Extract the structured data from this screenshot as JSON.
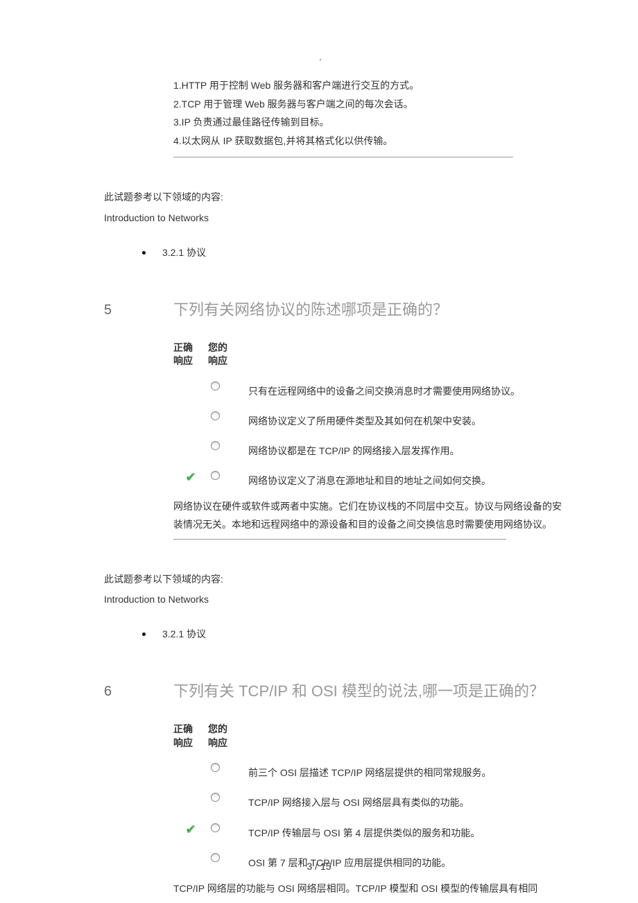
{
  "page_marker": ".",
  "top_explanation": {
    "lines": [
      "1.HTTP 用于控制 Web 服务器和客户端进行交互的方式。",
      "2.TCP 用于管理 Web 服务器与客户端之间的每次会话。",
      "3.IP 负责通过最佳路径传输到目标。",
      "4.以太网从 IP 获取数据包,并将其格式化以供传输。"
    ]
  },
  "reference1": {
    "intro": "此试题参考以下领域的内容:",
    "course": "Introduction to Networks",
    "bullet": "3.2.1 协议"
  },
  "question5": {
    "number": "5",
    "title": "下列有关网络协议的陈述哪项是正确的？",
    "header_correct_l1": "正确",
    "header_correct_l2": "响应",
    "header_your_l1": "您的",
    "header_your_l2": "响应",
    "options": [
      {
        "text": "只有在远程网络中的设备之间交换消息时才需要使用网络协议。",
        "correct": false
      },
      {
        "text": "网络协议定义了所用硬件类型及其如何在机架中安装。",
        "correct": false
      },
      {
        "text": "网络协议都是在 TCP/IP 的网络接入层发挥作用。",
        "correct": false
      },
      {
        "text": "网络协议定义了消息在源地址和目的地址之间如何交换。",
        "correct": true
      }
    ],
    "explanation": "网络协议在硬件或软件或两者中实施。它们在协议栈的不同层中交互。协议与网络设备的安装情况无关。本地和远程网络中的源设备和目的设备之间交换信息时需要使用网络协议。"
  },
  "reference2": {
    "intro": "此试题参考以下领域的内容:",
    "course": "Introduction to Networks",
    "bullet": "3.2.1 协议"
  },
  "question6": {
    "number": "6",
    "title": "下列有关 TCP/IP 和 OSI 模型的说法,哪一项是正确的？",
    "header_correct_l1": "正确",
    "header_correct_l2": "响应",
    "header_your_l1": "您的",
    "header_your_l2": "响应",
    "options": [
      {
        "text": "前三个 OSI 层描述 TCP/IP 网络层提供的相同常规服务。",
        "correct": false
      },
      {
        "text": "TCP/IP 网络接入层与 OSI 网络层具有类似的功能。",
        "correct": false
      },
      {
        "text": "TCP/IP 传输层与 OSI 第 4 层提供类似的服务和功能。",
        "correct": true
      },
      {
        "text": "OSI 第 7 层和 TCP/IP 应用层提供相同的功能。",
        "correct": false
      }
    ],
    "explanation": "TCP/IP 网络层的功能与 OSI 网络层相同。TCP/IP 模型和 OSI 模型的传输层具有相同"
  },
  "footer": {
    "page": "3 / 15"
  }
}
